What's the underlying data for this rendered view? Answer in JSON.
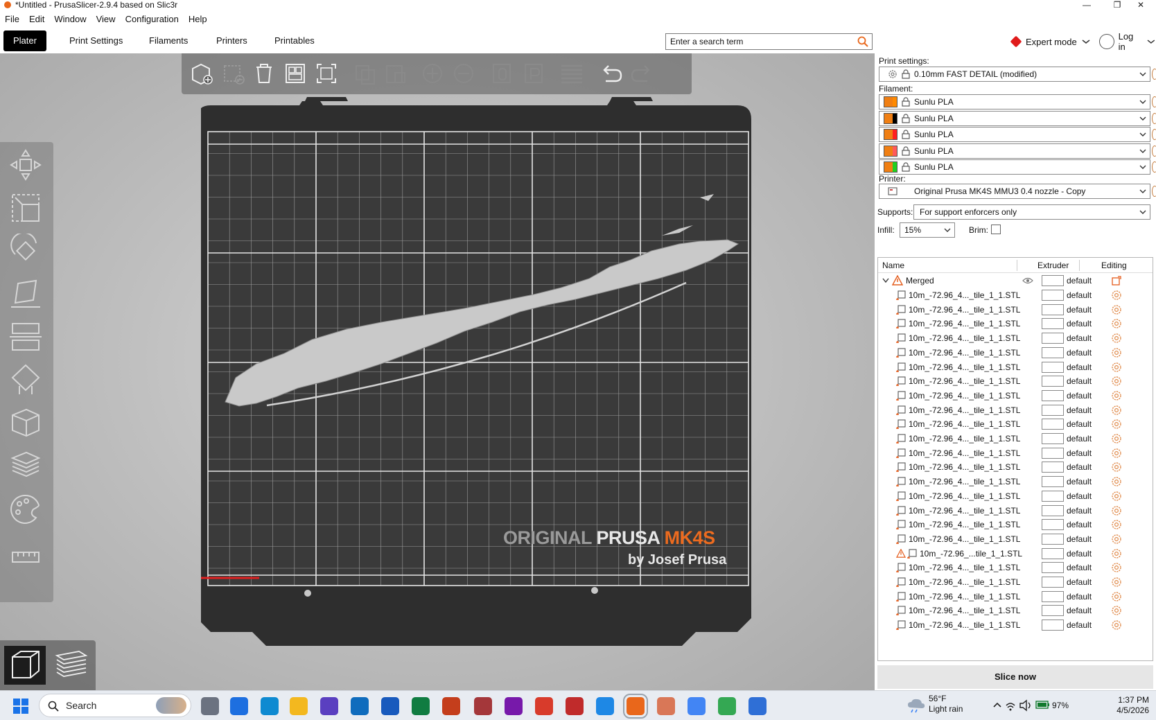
{
  "window": {
    "title": "*Untitled - PrusaSlicer-2.9.4 based on Slic3r",
    "minimize": "—",
    "maximize": "❐",
    "close": "✕"
  },
  "menu": [
    "File",
    "Edit",
    "Window",
    "View",
    "Configuration",
    "Help"
  ],
  "tabs": [
    "Plater",
    "Print Settings",
    "Filaments",
    "Printers",
    "Printables"
  ],
  "search": {
    "placeholder": "Enter a search term"
  },
  "mode": {
    "label": "Expert mode"
  },
  "login": {
    "label": "Log in"
  },
  "bed": {
    "brand_line1a": "ORIGINAL",
    "brand_line1b": "PRUSA",
    "brand_line1c": "MK4S",
    "brand_line2": "by Josef Prusa"
  },
  "print_settings": {
    "label": "Print settings:",
    "value": "0.10mm FAST DETAIL (modified)"
  },
  "filament": {
    "label": "Filament:",
    "items": [
      {
        "name": "Sunlu PLA",
        "color": "#f07f13",
        "extruder_color": "#ff8a00"
      },
      {
        "name": "Sunlu PLA",
        "color": "#f07f13",
        "extruder_color": "#000000"
      },
      {
        "name": "Sunlu PLA",
        "color": "#f07f13",
        "extruder_color": "#ff2020"
      },
      {
        "name": "Sunlu PLA",
        "color": "#f07f13",
        "extruder_color": "#ff5a5a"
      },
      {
        "name": "Sunlu PLA",
        "color": "#f07f13",
        "extruder_color": "#20d020"
      }
    ]
  },
  "printer": {
    "label": "Printer:",
    "value": "Original Prusa MK4S MMU3 0.4 nozzle - Copy"
  },
  "supports": {
    "label": "Supports:",
    "value": "For support enforcers only"
  },
  "infill": {
    "label": "Infill:",
    "value": "15%"
  },
  "brim": {
    "label": "Brim:",
    "checked": false
  },
  "object_list": {
    "headers": {
      "name": "Name",
      "extruder": "Extruder",
      "editing": "Editing"
    },
    "root": {
      "name": "Merged",
      "extruder": "default"
    },
    "parts": [
      {
        "name": "10m_-72.96_4..._tile_1_1.STL",
        "extruder": "default"
      },
      {
        "name": "10m_-72.96_4..._tile_1_1.STL",
        "extruder": "default"
      },
      {
        "name": "10m_-72.96_4..._tile_1_1.STL",
        "extruder": "default"
      },
      {
        "name": "10m_-72.96_4..._tile_1_1.STL",
        "extruder": "default"
      },
      {
        "name": "10m_-72.96_4..._tile_1_1.STL",
        "extruder": "default"
      },
      {
        "name": "10m_-72.96_4..._tile_1_1.STL",
        "extruder": "default"
      },
      {
        "name": "10m_-72.96_4..._tile_1_1.STL",
        "extruder": "default"
      },
      {
        "name": "10m_-72.96_4..._tile_1_1.STL",
        "extruder": "default"
      },
      {
        "name": "10m_-72.96_4..._tile_1_1.STL",
        "extruder": "default"
      },
      {
        "name": "10m_-72.96_4..._tile_1_1.STL",
        "extruder": "default"
      },
      {
        "name": "10m_-72.96_4..._tile_1_1.STL",
        "extruder": "default"
      },
      {
        "name": "10m_-72.96_4..._tile_1_1.STL",
        "extruder": "default"
      },
      {
        "name": "10m_-72.96_4..._tile_1_1.STL",
        "extruder": "default"
      },
      {
        "name": "10m_-72.96_4..._tile_1_1.STL",
        "extruder": "default"
      },
      {
        "name": "10m_-72.96_4..._tile_1_1.STL",
        "extruder": "default"
      },
      {
        "name": "10m_-72.96_4..._tile_1_1.STL",
        "extruder": "default"
      },
      {
        "name": "10m_-72.96_4..._tile_1_1.STL",
        "extruder": "default"
      },
      {
        "name": "10m_-72.96_4..._tile_1_1.STL",
        "extruder": "default"
      },
      {
        "name": "10m_-72.96_...tile_1_1.STL",
        "extruder": "default",
        "warning": true
      },
      {
        "name": "10m_-72.96_4..._tile_1_1.STL",
        "extruder": "default"
      },
      {
        "name": "10m_-72.96_4..._tile_1_1.STL",
        "extruder": "default"
      },
      {
        "name": "10m_-72.96_4..._tile_1_1.STL",
        "extruder": "default"
      },
      {
        "name": "10m_-72.96_4..._tile_1_1.STL",
        "extruder": "default"
      },
      {
        "name": "10m_-72.96_4..._tile_1_1.STL",
        "extruder": "default"
      }
    ]
  },
  "slice_button": {
    "label": "Slice now"
  },
  "taskbar": {
    "search": "Search",
    "weather_temp": "56°F",
    "weather_desc": "Light rain",
    "battery": "97%",
    "time": "1:37 PM",
    "date": "4/5/2026"
  },
  "colors": {
    "accent": "#ec6b1f",
    "active_tab": "#000000",
    "slice_bg": "#e6e6e6"
  }
}
